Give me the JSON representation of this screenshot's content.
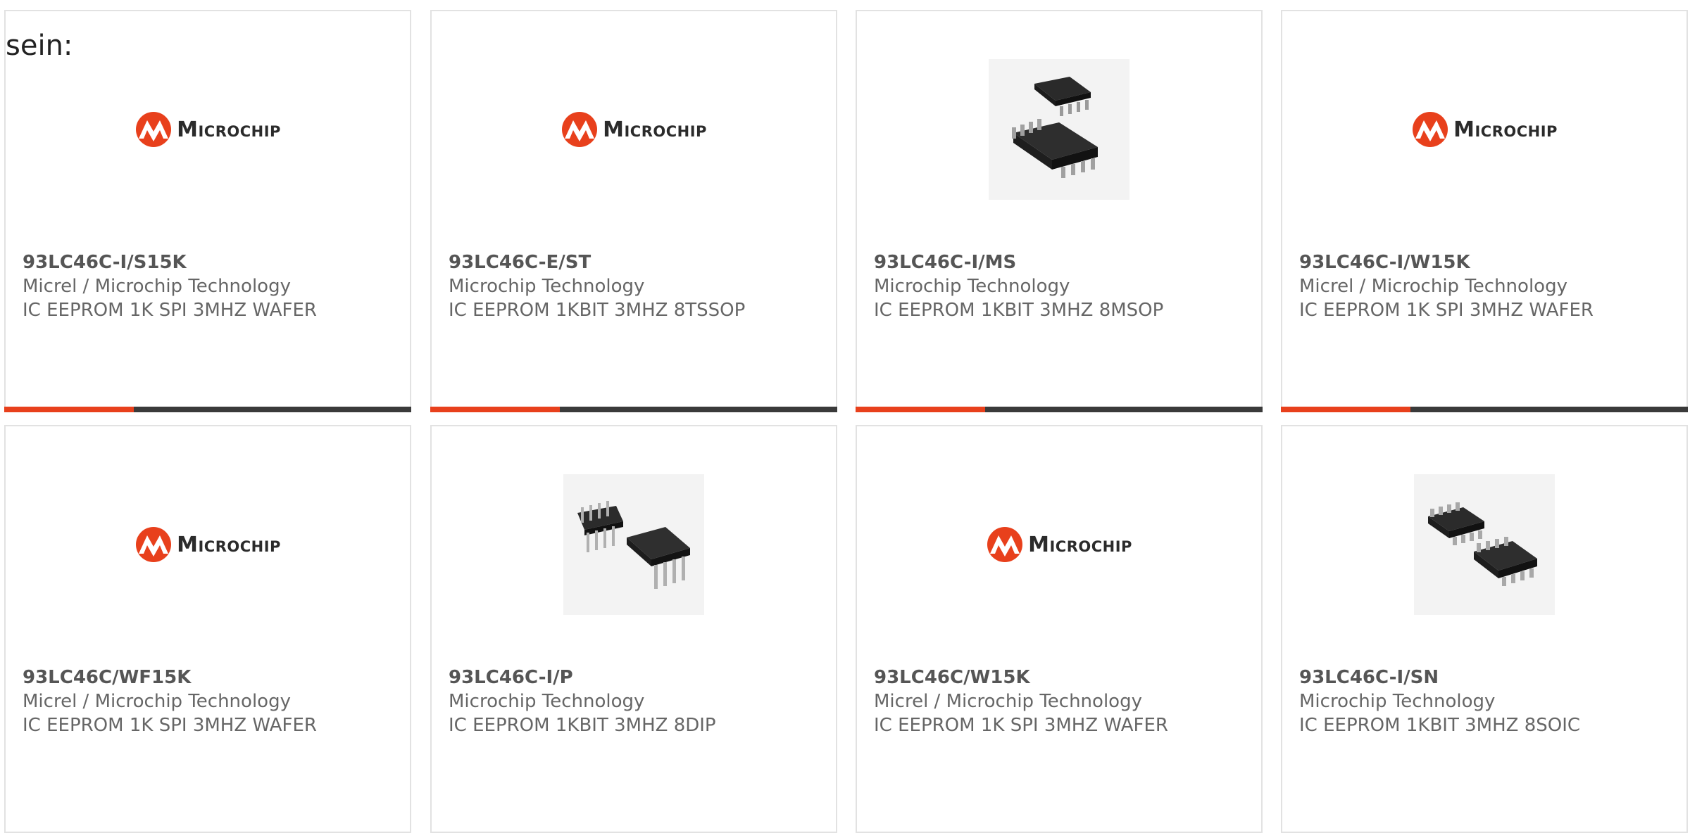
{
  "intro_text": "sein:",
  "colors": {
    "accent": "#e8401c",
    "bar_dark": "#3a3a3a",
    "text_muted": "#666666",
    "logo_red": "#e8401c"
  },
  "logo": {
    "text": "Microchip"
  },
  "products": [
    {
      "part": "93LC46C-I/S15K",
      "manufacturer": "Micrel / Microchip Technology",
      "description": "IC EEPROM 1K SPI 3MHZ WAFER",
      "image": "microchip-logo"
    },
    {
      "part": "93LC46C-E/ST",
      "manufacturer": "Microchip Technology",
      "description": "IC EEPROM 1KBIT 3MHZ 8TSSOP",
      "image": "microchip-logo"
    },
    {
      "part": "93LC46C-I/MS",
      "manufacturer": "Microchip Technology",
      "description": "IC EEPROM 1KBIT 3MHZ 8MSOP",
      "image": "msop-chip"
    },
    {
      "part": "93LC46C-I/W15K",
      "manufacturer": "Micrel / Microchip Technology",
      "description": "IC EEPROM 1K SPI 3MHZ WAFER",
      "image": "microchip-logo"
    },
    {
      "part": "93LC46C/WF15K",
      "manufacturer": "Micrel / Microchip Technology",
      "description": "IC EEPROM 1K SPI 3MHZ WAFER",
      "image": "microchip-logo"
    },
    {
      "part": "93LC46C-I/P",
      "manufacturer": "Microchip Technology",
      "description": "IC EEPROM 1KBIT 3MHZ 8DIP",
      "image": "dip-chip"
    },
    {
      "part": "93LC46C/W15K",
      "manufacturer": "Micrel / Microchip Technology",
      "description": "IC EEPROM 1K SPI 3MHZ WAFER",
      "image": "microchip-logo"
    },
    {
      "part": "93LC46C-I/SN",
      "manufacturer": "Microchip Technology",
      "description": "IC EEPROM 1KBIT 3MHZ 8SOIC",
      "image": "soic-chip"
    }
  ]
}
